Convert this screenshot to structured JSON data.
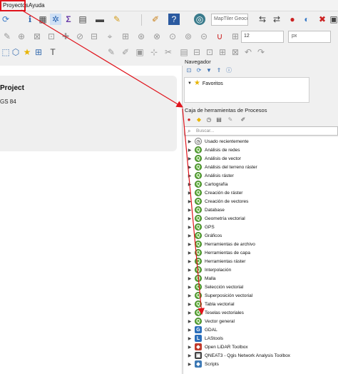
{
  "menubar": {
    "items": [
      "Proyectos",
      "Ayuda"
    ]
  },
  "toolbar": {
    "search_placeholder": "MapTiler Geocod...",
    "size_value": "12",
    "unit_value": "px"
  },
  "project": {
    "title": "Project",
    "crs": "GS 84"
  },
  "navigator": {
    "title": "Navegador",
    "favorites": "Favoritos"
  },
  "processing": {
    "title": "Caja de herramientas de Procesos",
    "search_placeholder": "Buscar...",
    "items": [
      "Usado recientemente",
      "Análisis de redes",
      "Análisis de vector",
      "Análisis del terreno ráster",
      "Análisis ráster",
      "Cartografía",
      "Creación de ráster",
      "Creación de vectores",
      "Database",
      "Geometría vectorial",
      "GPS",
      "Gráficos",
      "Herramientas de archivo",
      "Herramientas de capa",
      "Herramientas ráster",
      "Interpolación",
      "Malla",
      "Selección vectorial",
      "Superposición vectorial",
      "Tabla vectorial",
      "Teselas vectoriales",
      "Vector general",
      "GDAL",
      "LAStools",
      "Open LiDAR Toolbox",
      "QNEAT3 - Qgis Network Analysis Toolbox",
      "Scripts"
    ]
  },
  "colors": {
    "highlight": "#e0141c",
    "qgis_green": "#5fae3a"
  }
}
